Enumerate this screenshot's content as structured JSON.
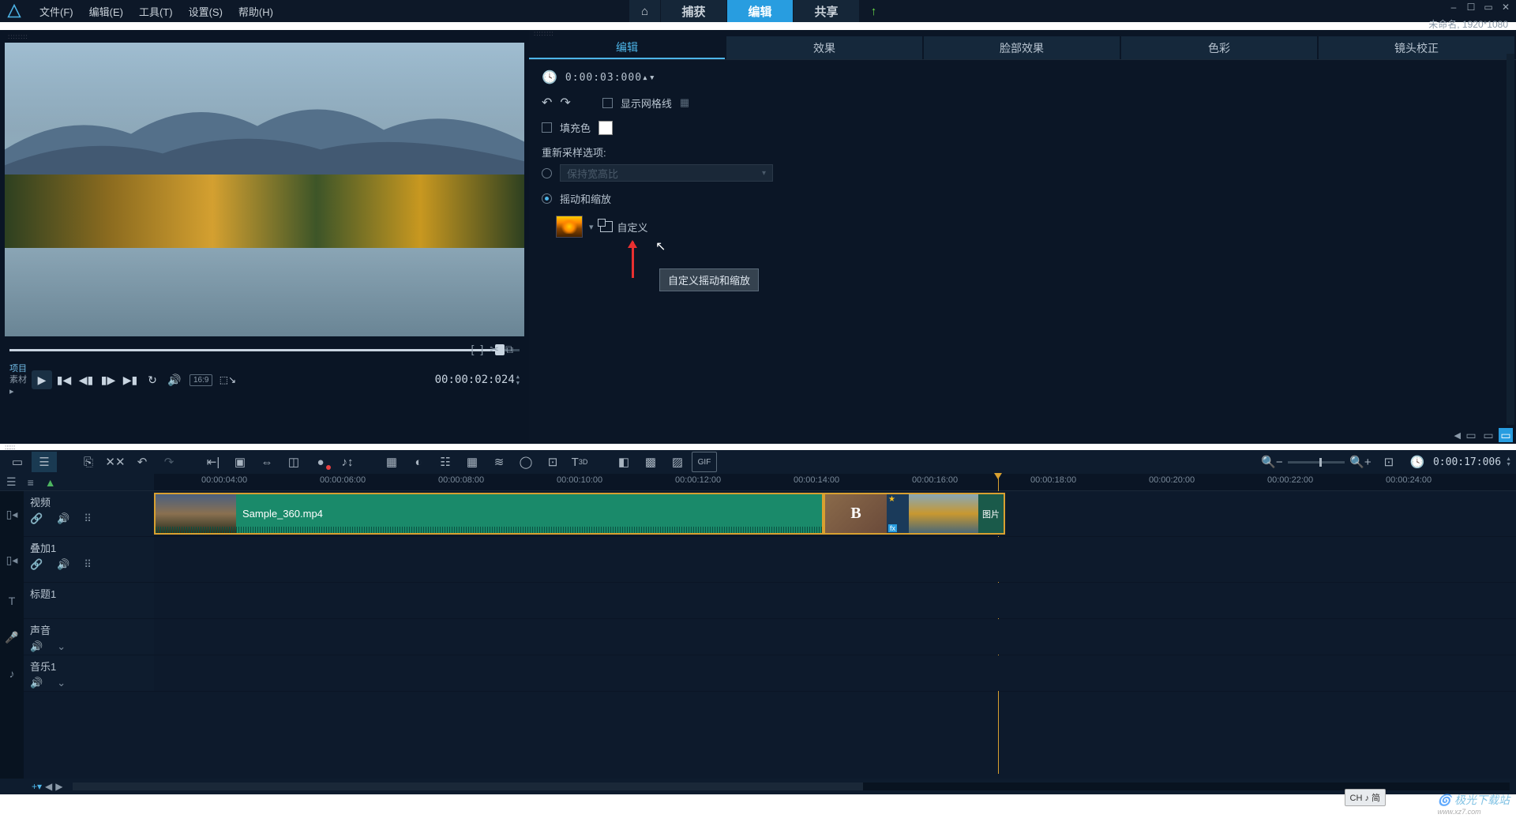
{
  "menubar": {
    "items": [
      "文件(F)",
      "编辑(E)",
      "工具(T)",
      "设置(S)",
      "帮助(H)"
    ]
  },
  "topnav": {
    "home_icon": "⌂",
    "capture": "捕获",
    "edit": "编辑",
    "share": "共享",
    "upload_icon": "↑"
  },
  "project_info": "未命名, 1920*1080",
  "preview": {
    "project_label": "项目",
    "asset_label": "素材",
    "timecode": "00:00:02:024",
    "aspect": "16:9",
    "mark_in": "[",
    "mark_out": "]",
    "split": "✂",
    "snap": "⧉"
  },
  "edit_tabs": [
    "编辑",
    "效果",
    "脸部效果",
    "色彩",
    "镜头校正"
  ],
  "edit_panel": {
    "duration_label_icon": "🕓",
    "duration_value": "0:00:03:000",
    "show_grid": "显示网格线",
    "fill_color": "填充色",
    "resample_label": "重新采样选项:",
    "resample_option": "保持宽高比",
    "pan_zoom": "摇动和缩放",
    "custom": "自定义",
    "tooltip": "自定义摇动和缩放"
  },
  "toolbar": {
    "zoom_out": "−",
    "zoom_in": "+",
    "fit": "⊡",
    "timecode": "0:00:17:006"
  },
  "ruler": {
    "ticks": [
      "00:00:04:00",
      "00:00:06:00",
      "00:00:08:00",
      "00:00:10:00",
      "00:00:12:00",
      "00:00:14:00",
      "00:00:16:00",
      "00:00:18:00",
      "00:00:20:00",
      "00:00:22:00",
      "00:00:24:00"
    ]
  },
  "tracks": {
    "video": {
      "name": "视频",
      "clip": "Sample_360.mp4",
      "image_label": "图片"
    },
    "overlay": {
      "name": "叠加1"
    },
    "title": {
      "name": "标题1"
    },
    "voice": {
      "name": "声音"
    },
    "music": {
      "name": "音乐1"
    }
  },
  "ime": "CH ♪ 简",
  "watermark": {
    "brand": "极光下载站",
    "url": "www.xz7.com"
  }
}
